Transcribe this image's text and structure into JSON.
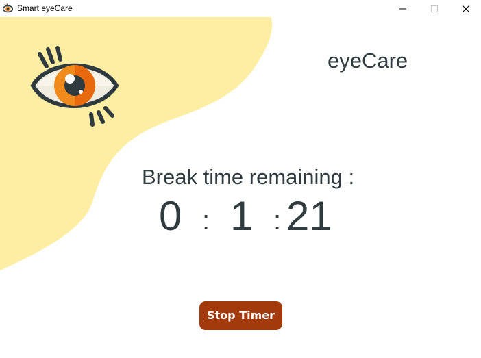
{
  "window": {
    "title": "Smart eyeCare",
    "icon": "eye-icon"
  },
  "header": {
    "app_name": "eyeCare"
  },
  "main": {
    "break_label": "Break time remaining :",
    "timer": {
      "hours": "0",
      "separator_1": ":",
      "minutes": "1",
      "separator_2": ":",
      "seconds": "21"
    },
    "stop_button_label": "Stop Timer"
  },
  "colors": {
    "blob": "#fdeea3",
    "button": "#a33a0c",
    "text": "#2f3b3f",
    "iris": "#f07a12"
  }
}
